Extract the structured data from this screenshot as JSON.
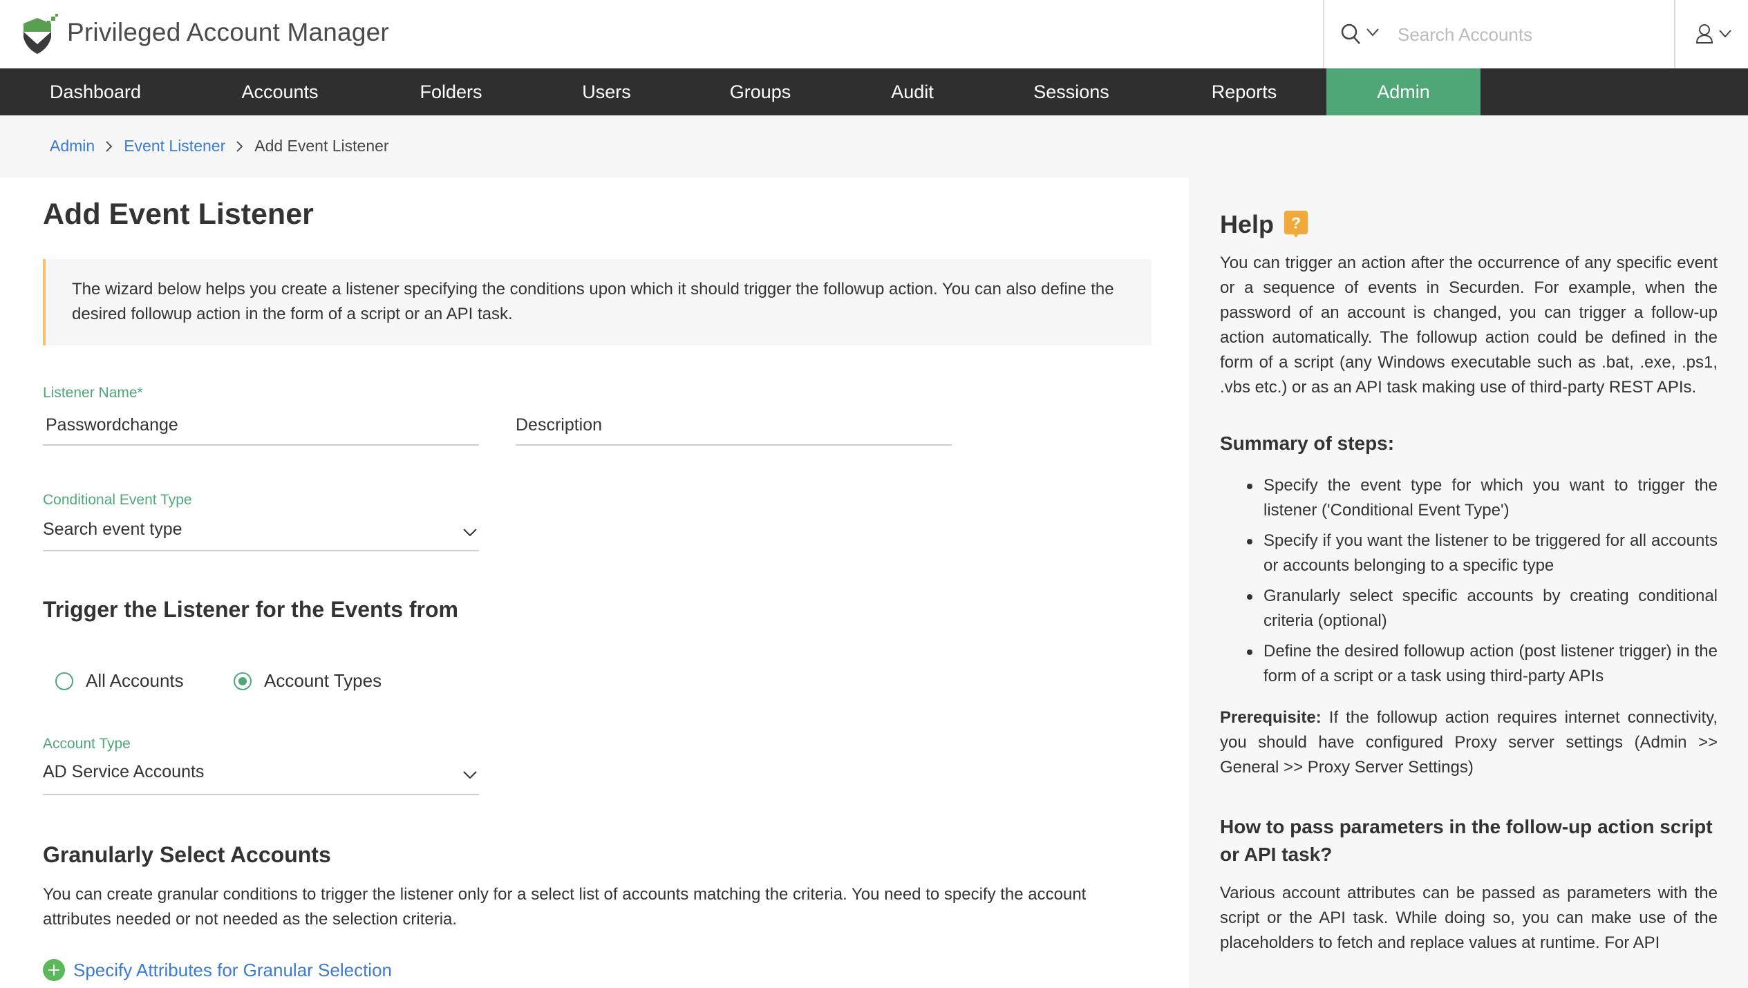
{
  "header": {
    "app_title": "Privileged Account Manager",
    "search_placeholder": "Search Accounts"
  },
  "nav": {
    "items": [
      {
        "label": "Dashboard",
        "active": false
      },
      {
        "label": "Accounts",
        "active": false
      },
      {
        "label": "Folders",
        "active": false
      },
      {
        "label": "Users",
        "active": false
      },
      {
        "label": "Groups",
        "active": false
      },
      {
        "label": "Audit",
        "active": false
      },
      {
        "label": "Sessions",
        "active": false
      },
      {
        "label": "Reports",
        "active": false
      },
      {
        "label": "Admin",
        "active": true
      }
    ]
  },
  "breadcrumb": {
    "items": [
      "Admin",
      "Event Listener"
    ],
    "current": "Add Event Listener"
  },
  "page": {
    "title": "Add Event Listener",
    "info": "The wizard below helps you create a listener specifying the conditions upon which it should trigger the followup action. You can also define the desired followup action in the form of a script or an API task."
  },
  "form": {
    "listener_name": {
      "label": "Listener Name*",
      "value": "Passwordchange"
    },
    "description": {
      "placeholder": "Description",
      "value": ""
    },
    "event_type": {
      "label": "Conditional Event Type",
      "placeholder": "Search event type"
    },
    "trigger_heading": "Trigger the Listener for the Events from",
    "radio_all": {
      "label": "All Accounts",
      "checked": false
    },
    "radio_types": {
      "label": "Account Types",
      "checked": true
    },
    "account_type": {
      "label": "Account Type",
      "value": "AD Service Accounts"
    },
    "granular_heading": "Granularly Select Accounts",
    "granular_text": "You can create granular conditions to trigger the listener only for a select list of accounts matching the criteria. You need to specify the account attributes needed or not needed as the selection criteria.",
    "granular_link": "Specify Attributes for Granular Selection"
  },
  "help": {
    "title": "Help",
    "badge": "?",
    "intro": "You can trigger an action after the occurrence of any specific event or a sequence of events in Securden. For example, when the password of an account is changed, you can trigger a follow-up action automatically. The followup action could be defined in the form of a script (any Windows executable such as .bat, .exe, .ps1, .vbs etc.) or as an API task making use of third-party REST APIs.",
    "summary_heading": "Summary of steps:",
    "steps": [
      "Specify the event type for which you want to trigger the listener ('Conditional Event Type')",
      "Specify if you want the listener to be triggered for all accounts or accounts belonging to a specific type",
      "Granularly select specific accounts by creating conditional criteria (optional)",
      "Define the desired followup action (post listener trigger) in the form of a script or a task using third-party APIs"
    ],
    "prereq_label": "Prerequisite:",
    "prereq_text": " If the followup action requires internet connectivity, you should have configured Proxy server settings (Admin >> General >> Proxy Server Settings)",
    "params_heading": "How to pass parameters in the follow-up action script or API task?",
    "params_text": "Various account attributes can be passed as parameters with the script or the API task. While doing so, you can make use of the placeholders to fetch and replace values at runtime. For API"
  },
  "colors": {
    "accent_green": "#4fa778",
    "nav_bg": "#2f2f2f",
    "link_blue": "#3a7bd5",
    "info_border": "#f6c26b",
    "help_badge": "#f0a93a"
  }
}
